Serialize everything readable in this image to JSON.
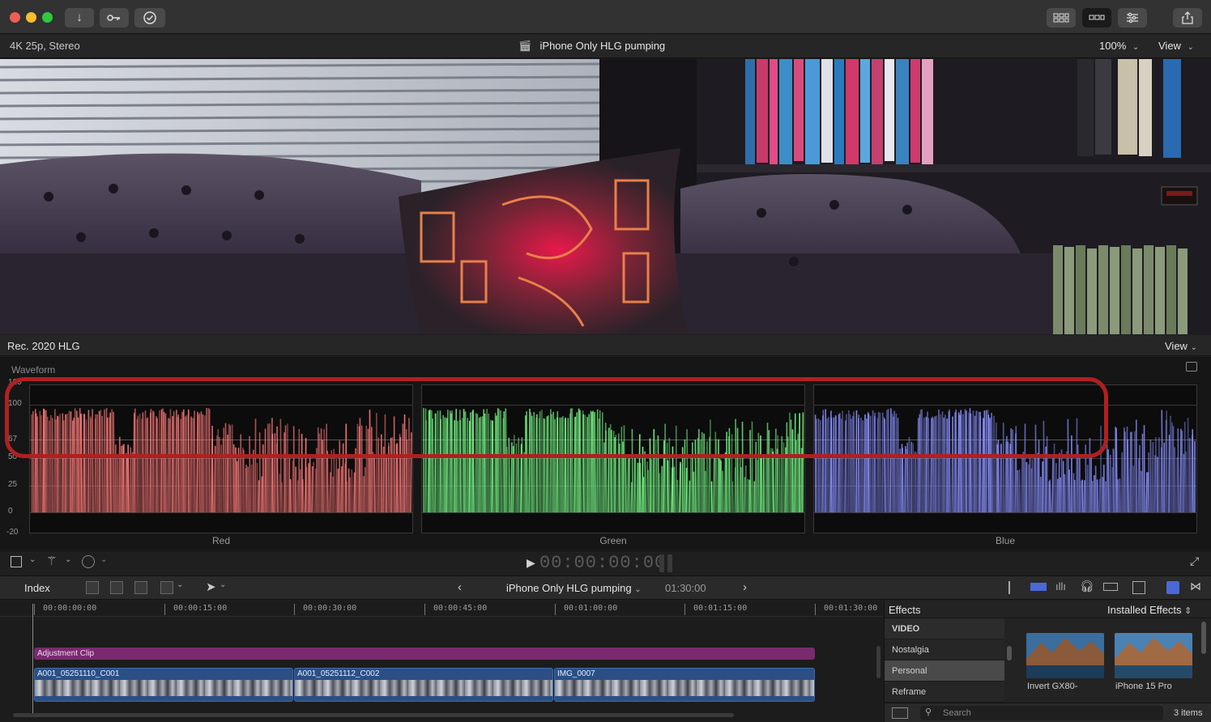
{
  "window": {
    "title_bar": {
      "buttons": [
        "import-arrow-icon",
        "key-icon",
        "checkmark-circle-icon"
      ],
      "view_buttons": [
        "grid-icon",
        "filmstrip-icon",
        "sliders-icon"
      ],
      "share": "share-icon"
    }
  },
  "viewer": {
    "format_label": "4K 25p, Stereo",
    "project_title": "iPhone Only HLG pumping",
    "zoom": "100%",
    "view_menu": "View"
  },
  "scopes": {
    "color_space": "Rec. 2020 HLG",
    "view_menu": "View",
    "scope_type": "Waveform",
    "y_labels": [
      "120",
      "100",
      "67",
      "50",
      "25",
      "0",
      "-20"
    ],
    "channels": [
      {
        "name": "Red",
        "color": "#ff7a7a"
      },
      {
        "name": "Green",
        "color": "#7aff8a"
      },
      {
        "name": "Blue",
        "color": "#8a90ff"
      }
    ],
    "highlight_color": "#b02020"
  },
  "transport": {
    "timecode": "00:00:00:00"
  },
  "timeline_toolbar": {
    "index_label": "Index",
    "project_name": "iPhone Only HLG pumping",
    "duration": "01:30:00"
  },
  "timeline": {
    "ruler": [
      "00:00:00:00",
      "00:00:15:00",
      "00:00:30:00",
      "00:00:45:00",
      "00:01:00:00",
      "00:01:15:00",
      "00:01:30:00"
    ],
    "adjustment_clip": "Adjustment Clip",
    "clips": [
      "A001_05251110_C001",
      "A001_05251112_C002",
      "IMG_0007"
    ]
  },
  "effects": {
    "title": "Effects",
    "installed_label": "Installed Effects",
    "categories": [
      "VIDEO",
      "Nostalgia",
      "Personal",
      "Reframe"
    ],
    "selected": "Personal",
    "thumbnails": [
      "Invert GX80-",
      "iPhone 15 Pro"
    ],
    "search_placeholder": "Search",
    "count": "3 items"
  }
}
